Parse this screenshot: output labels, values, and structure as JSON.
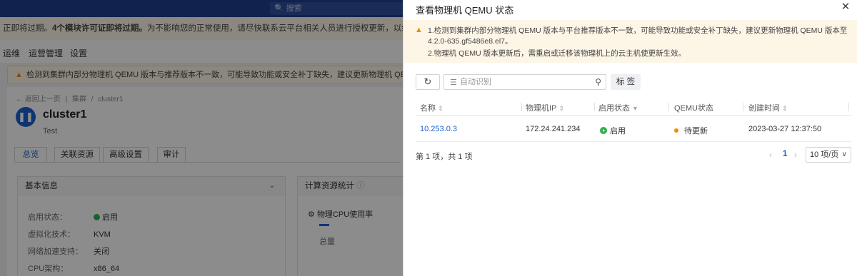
{
  "background": {
    "search_placeholder": "搜索",
    "license_text": "正即将过期。",
    "license_bold": "4个模块许可证即将过期。",
    "license_rest": "为不影响您的正常使用，请尽快联系云平台相关人员进行授权更新，以继续使用本产品。",
    "nav": [
      "运维",
      "运营管理",
      "设置"
    ],
    "warning": "检测到集群内部分物理机 QEMU 版本与推荐版本不一致，可能导致功能或安全补丁缺失，建议更新物理机 QEMU 版本至",
    "breadcrumb": [
      "← 返回上一页",
      "|",
      "集群",
      "/",
      "cluster1"
    ],
    "cluster_name": "cluster1",
    "cluster_desc": "Test",
    "tabs": [
      "总览",
      "关联资源",
      "高级设置",
      "审计"
    ],
    "basic_info_title": "基本信息",
    "basic_info": [
      {
        "k": "启用状态：",
        "v": "启用"
      },
      {
        "k": "虚拟化技术：",
        "v": "KVM"
      },
      {
        "k": "网络加速支持：",
        "v": "关闭"
      },
      {
        "k": "CPU架构：",
        "v": "x86_64"
      }
    ],
    "compute_title": "计算资源统计",
    "cpu_title": "物理CPU使用率",
    "total_label": "总量"
  },
  "drawer": {
    "title": "查看物理机 QEMU 状态",
    "alert_line1": "1.检测到集群内部分物理机 QEMU 版本与平台推荐版本不一致，可能导致功能或安全补丁缺失，建议更新物理机 QEMU 版本至 4.2.0-635.gf5486e8.el7。",
    "alert_line2": "2.物理机 QEMU 版本更新后，需重启或迁移该物理机上的云主机使更新生效。",
    "search_placeholder": "自动识别",
    "tag_button": "标 签",
    "columns": [
      "名称",
      "物理机IP",
      "启用状态",
      "QEMU状态",
      "创建时间"
    ],
    "rows": [
      {
        "name": "10.253.0.3",
        "ip": "172.24.241.234",
        "enable": "启用",
        "qemu": "待更新",
        "created": "2023-03-27 12:37:50"
      }
    ],
    "summary": "第 1 项，共 1 项",
    "page": "1",
    "page_size": "10 项/页",
    "colors": {
      "accent": "#1a5fcf",
      "success": "#2bb24c",
      "warning": "#f08c00"
    }
  }
}
